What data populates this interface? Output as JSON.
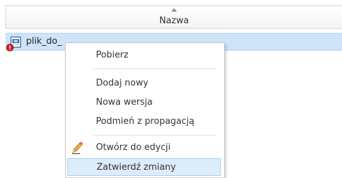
{
  "column_header": {
    "title": "Nazwa",
    "sort": "ascending"
  },
  "file_row": {
    "name": "plik_do_",
    "selected": true,
    "icon": "word-document-icon",
    "overlay_icon": "error-badge-icon"
  },
  "context_menu": {
    "items": [
      {
        "label": "Pobierz",
        "icon": null
      },
      {
        "label": "Dodaj nowy",
        "icon": null
      },
      {
        "label": "Nowa wersja",
        "icon": null
      },
      {
        "label": "Podmień z propagacją",
        "icon": null
      },
      {
        "label": "Otwórz do edycji",
        "icon": "pencil-icon"
      },
      {
        "label": "Zatwierdź zmiany",
        "icon": null,
        "highlighted": true
      }
    ]
  },
  "colors": {
    "selection_row": "#cfe3f9",
    "menu_highlight": "#dcecfb",
    "menu_highlight_border": "#a8cdf0"
  }
}
